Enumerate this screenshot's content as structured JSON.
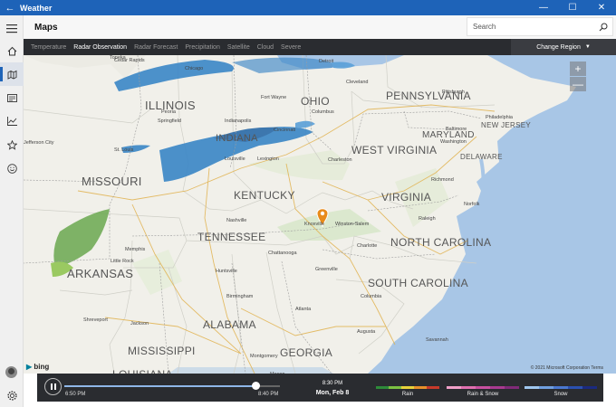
{
  "window": {
    "title": "Weather",
    "back_glyph": "←",
    "minimize": "—",
    "maximize": "☐",
    "close": "✕"
  },
  "header": {
    "title": "Maps",
    "search_placeholder": "Search"
  },
  "rail": {
    "items": [
      {
        "name": "hamburger-menu-icon",
        "glyph": "☰"
      },
      {
        "name": "home-icon",
        "glyph": "⌂"
      },
      {
        "name": "maps-icon",
        "glyph": "🗺"
      },
      {
        "name": "news-icon",
        "glyph": "✉"
      },
      {
        "name": "historical-weather-icon",
        "glyph": "📈"
      },
      {
        "name": "favorites-icon",
        "glyph": "☆"
      },
      {
        "name": "feedback-icon",
        "glyph": "☺"
      }
    ],
    "settings_glyph": "⚙"
  },
  "layers": {
    "tabs": [
      "Temperature",
      "Radar Observation",
      "Radar Forecast",
      "Precipitation",
      "Satellite",
      "Cloud",
      "Severe"
    ],
    "active_index": 1,
    "change_region": "Change Region"
  },
  "map": {
    "states": [
      "ILLINOIS",
      "OHIO",
      "PENNSYLVANIA",
      "INDIANA",
      "WEST VIRGINIA",
      "MARYLAND",
      "NEW JERSEY",
      "DELAWARE",
      "MISSOURI",
      "KENTUCKY",
      "VIRGINIA",
      "TENNESSEE",
      "NORTH CAROLINA",
      "ARKANSAS",
      "SOUTH CAROLINA",
      "ALABAMA",
      "MISSISSIPPI",
      "GEORGIA",
      "LOUISIANA"
    ],
    "cities": [
      "Cedar Rapids",
      "Chicago",
      "Detroit",
      "Cleveland",
      "Pittsburgh",
      "Philadelphia",
      "Columbus",
      "Springfield",
      "Indianapolis",
      "Cincinnati",
      "St. Louis",
      "Louisville",
      "Charleston",
      "Washington",
      "Baltimore",
      "Richmond",
      "Nashville",
      "Knoxville",
      "Winston-Salem",
      "Charlotte",
      "Raleigh",
      "Memphis",
      "Little Rock",
      "Birmingham",
      "Atlanta",
      "Columbia",
      "Jackson",
      "Shreveport",
      "Jefferson City",
      "Lexington",
      "Norfolk",
      "Chattanooga",
      "Huntsville",
      "Augusta",
      "Montgomery",
      "Macon",
      "Savannah",
      "Greenville",
      "Topeka",
      "Peoria",
      "Fort Wayne"
    ],
    "zoom_in": "+",
    "zoom_out": "—",
    "bing": "bing",
    "copyright": "© 2021 Microsoft Corporation  Terms"
  },
  "timeline": {
    "start_time": "6:50 PM",
    "end_time": "8:40 PM",
    "current_time": "8:30 PM",
    "current_date": "Mon, Feb 8",
    "progress": 0.89
  },
  "legend": [
    {
      "label": "Rain",
      "colors": [
        "#2e8b3a",
        "#7cc242",
        "#e8d23a",
        "#e8902a",
        "#c83a2a"
      ]
    },
    {
      "label": "Rain & Snow",
      "colors": [
        "#f0a0c8",
        "#e070b0",
        "#c850a0",
        "#a83a90",
        "#802a78"
      ]
    },
    {
      "label": "Snow",
      "colors": [
        "#a0c8f0",
        "#70a0e0",
        "#4a78d0",
        "#2a50b0",
        "#1a2a80"
      ]
    }
  ]
}
